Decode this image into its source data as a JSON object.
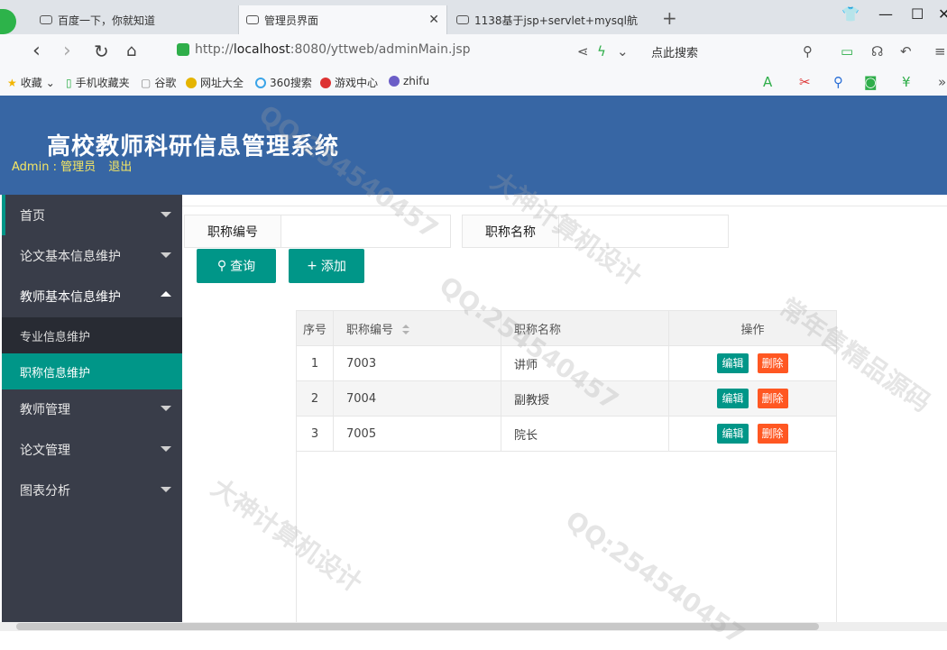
{
  "browser": {
    "tabs": [
      {
        "title": "百度一下，你就知道"
      },
      {
        "title": "管理员界面"
      },
      {
        "title": "1138基于jsp+servlet+mysql航"
      }
    ],
    "url_prefix": "http://",
    "url_host": "localhost",
    "url_rest": ":8080/yttweb/adminMain.jsp",
    "search_placeholder": "点此搜索",
    "bookmarks": [
      "收藏",
      "手机收藏夹",
      "谷歌",
      "网址大全",
      "360搜索",
      "游戏中心",
      "zhifu"
    ]
  },
  "header": {
    "title": "高校教师科研信息管理系统",
    "user_prefix": "Admin : ",
    "role": "管理员",
    "logout": "退出"
  },
  "sidebar": {
    "items": [
      {
        "label": "首页"
      },
      {
        "label": "论文基本信息维护"
      },
      {
        "label": "教师基本信息维护"
      },
      {
        "label": "教师管理"
      },
      {
        "label": "论文管理"
      },
      {
        "label": "图表分析"
      }
    ],
    "subitems": [
      {
        "label": "专业信息维护"
      },
      {
        "label": "职称信息维护"
      }
    ]
  },
  "search": {
    "code_label": "职称编号",
    "name_label": "职称名称",
    "code_value": "",
    "name_value": "",
    "query_button": "查询",
    "add_button": "添加"
  },
  "table": {
    "headers": [
      "序号",
      "职称编号",
      "职称名称",
      "操作"
    ],
    "rows": [
      {
        "index": "1",
        "code": "7003",
        "name": "讲师"
      },
      {
        "index": "2",
        "code": "7004",
        "name": "副教授"
      },
      {
        "index": "3",
        "code": "7005",
        "name": "院长"
      }
    ],
    "edit_label": "编辑",
    "delete_label": "删除"
  },
  "watermark": {
    "qq": "QQ:254540457",
    "design": "大神计算机设计",
    "source": "常年售精品源码"
  },
  "colors": {
    "header": "#3766a4",
    "sidebar": "#393d49",
    "accent": "#009688",
    "danger": "#ff5722",
    "user_text": "#f5e663"
  }
}
